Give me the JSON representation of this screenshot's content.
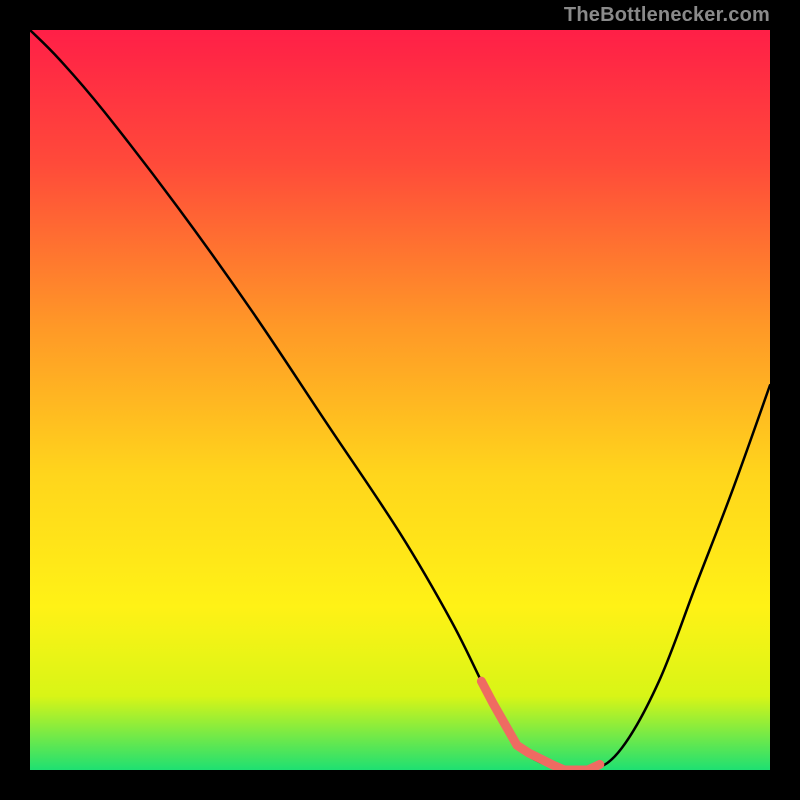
{
  "watermark": "TheBottlenecker.com",
  "chart_data": {
    "type": "line",
    "title": "",
    "xlabel": "",
    "ylabel": "",
    "xlim": [
      0,
      100
    ],
    "ylim": [
      0,
      100
    ],
    "grid": false,
    "gradient_stops": [
      {
        "offset": 0,
        "color": "#ff1f47"
      },
      {
        "offset": 18,
        "color": "#ff4a3a"
      },
      {
        "offset": 40,
        "color": "#ff9827"
      },
      {
        "offset": 60,
        "color": "#ffd51c"
      },
      {
        "offset": 78,
        "color": "#fff216"
      },
      {
        "offset": 90,
        "color": "#d8f516"
      },
      {
        "offset": 100,
        "color": "#1ee072"
      }
    ],
    "series": [
      {
        "name": "bottleneck-curve",
        "color": "#000000",
        "x": [
          0,
          4,
          10,
          20,
          30,
          40,
          50,
          57,
          62,
          66,
          72,
          76,
          80,
          85,
          90,
          95,
          100
        ],
        "values": [
          100,
          96,
          89,
          76,
          62,
          47,
          32,
          20,
          10,
          3,
          0,
          0,
          3,
          12,
          25,
          38,
          52
        ]
      }
    ],
    "highlight_segment": {
      "name": "optimal-range",
      "color": "#ef6b62",
      "x_start": 61,
      "x_end": 77
    }
  }
}
